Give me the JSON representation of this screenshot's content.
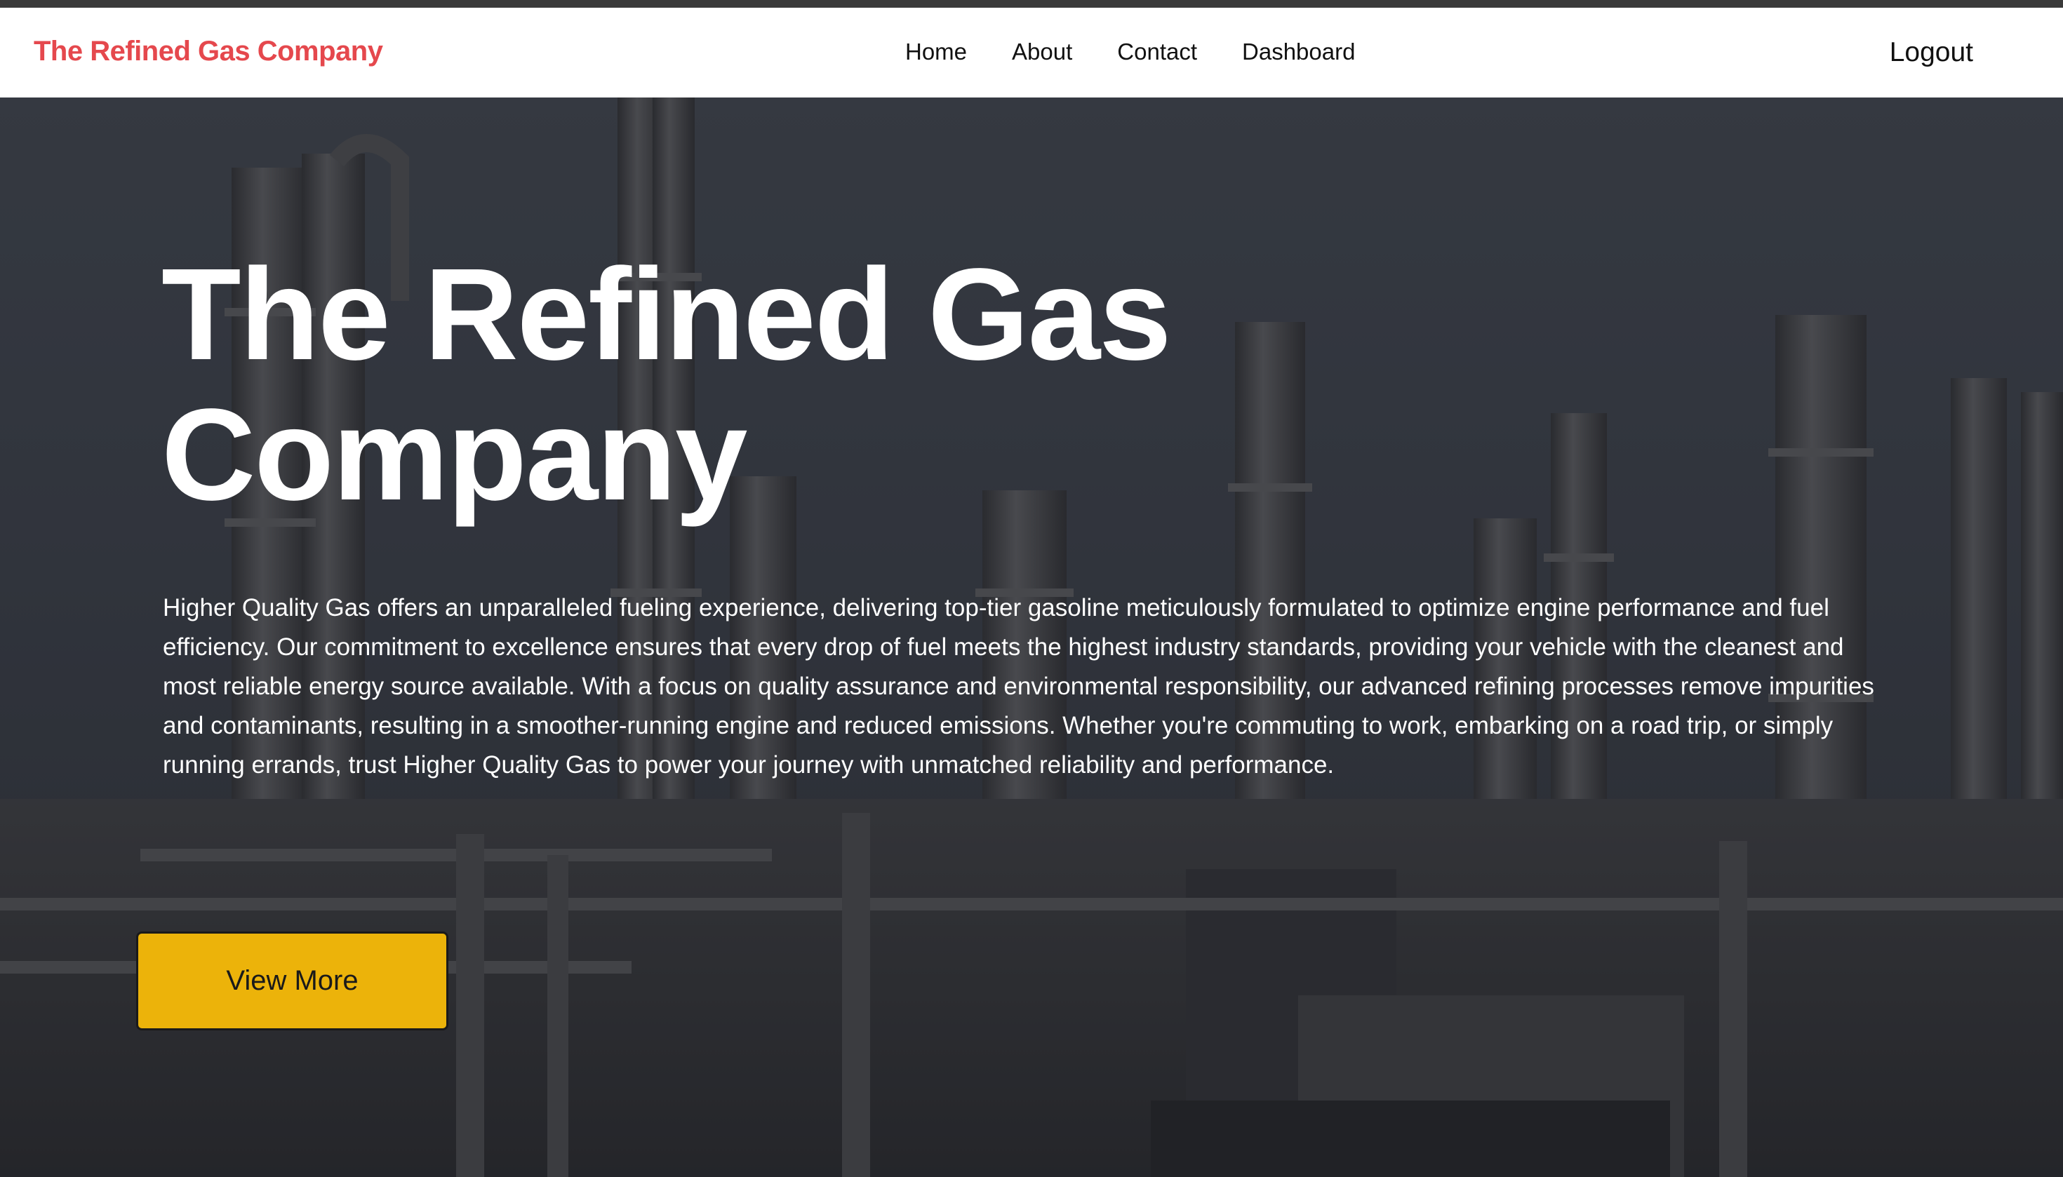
{
  "navbar": {
    "brand": "The Refined Gas Company",
    "links": [
      "Home",
      "About",
      "Contact",
      "Dashboard"
    ],
    "logout": "Logout"
  },
  "hero": {
    "title": "The Refined Gas Company",
    "description": "Higher Quality Gas offers an unparalleled fueling experience, delivering top-tier gasoline meticulously formulated to optimize engine performance and fuel efficiency. Our commitment to excellence ensures that every drop of fuel meets the highest industry standards, providing your vehicle with the cleanest and most reliable energy source available. With a focus on quality assurance and environmental responsibility, our advanced refining processes remove impurities and contaminants, resulting in a smoother-running engine and reduced emissions. Whether you're commuting to work, embarking on a road trip, or simply running errands, trust Higher Quality Gas to power your journey with unmatched reliability and performance.",
    "button": "View More",
    "background_image": "oil refinery towers and pipes"
  },
  "colors": {
    "brand": "#e5484d",
    "button": "#ecb30a",
    "hero_overlay": "#2f343c"
  }
}
